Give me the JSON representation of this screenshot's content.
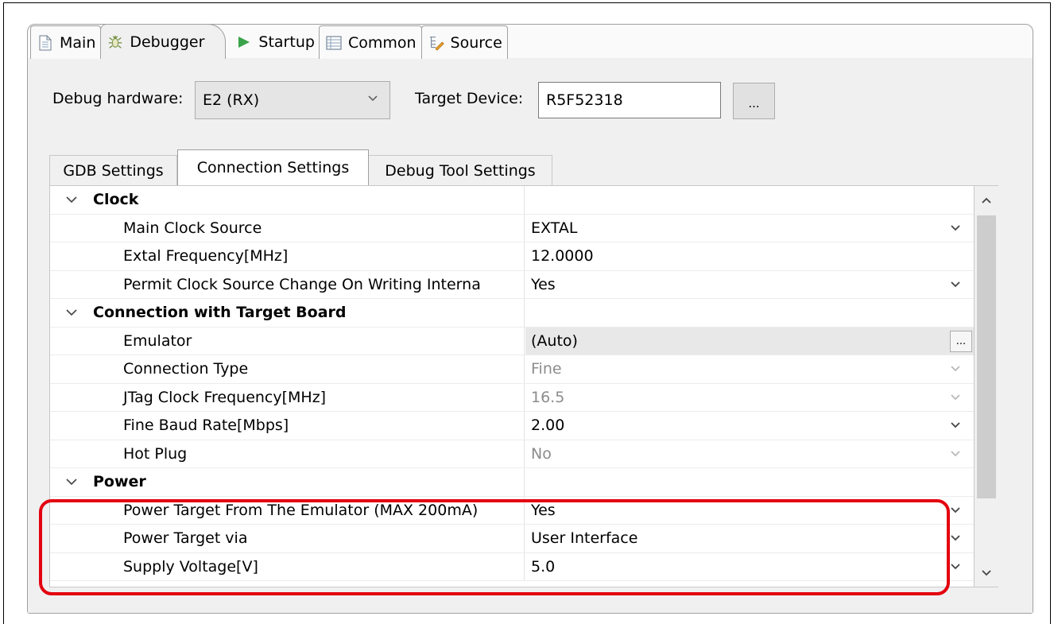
{
  "tabs": [
    {
      "label": "Main",
      "icon": "document-icon"
    },
    {
      "label": "Debugger",
      "icon": "bug-icon",
      "active": true
    },
    {
      "label": "Startup",
      "icon": "play-icon"
    },
    {
      "label": "Common",
      "icon": "table-icon"
    },
    {
      "label": "Source",
      "icon": "source-icon"
    }
  ],
  "debug_hardware": {
    "label": "Debug hardware:",
    "value": "E2 (RX)"
  },
  "target_device": {
    "label": "Target Device:",
    "value": "R5F52318",
    "browse_label": "..."
  },
  "inner_tabs": [
    {
      "label": "GDB Settings"
    },
    {
      "label": "Connection Settings",
      "active": true
    },
    {
      "label": "Debug Tool Settings"
    }
  ],
  "properties": {
    "clock": {
      "title": "Clock",
      "main_clock_source": {
        "name": "Main Clock Source",
        "value": "EXTAL"
      },
      "extal_frequency": {
        "name": "Extal Frequency[MHz]",
        "value": "12.0000"
      },
      "permit_clock_change": {
        "name": "Permit Clock Source Change On Writing Interna",
        "value": "Yes"
      }
    },
    "connection": {
      "title": "Connection with Target Board",
      "emulator": {
        "name": "Emulator",
        "value": "(Auto)",
        "browse_label": "..."
      },
      "connection_type": {
        "name": "Connection Type",
        "value": "Fine"
      },
      "jtag_clock": {
        "name": "JTag Clock Frequency[MHz]",
        "value": "16.5"
      },
      "fine_baud": {
        "name": "Fine Baud Rate[Mbps]",
        "value": "2.00"
      },
      "hot_plug": {
        "name": "Hot Plug",
        "value": "No"
      }
    },
    "power": {
      "title": "Power",
      "power_target": {
        "name": "Power Target From The Emulator (MAX 200mA)",
        "value": "Yes"
      },
      "power_via": {
        "name": "Power Target via",
        "value": "User Interface"
      },
      "supply_voltage": {
        "name": "Supply Voltage[V]",
        "value": "5.0"
      }
    }
  },
  "colors": {
    "highlight": "#e3000f",
    "startup_icon": "#3aa34a"
  }
}
